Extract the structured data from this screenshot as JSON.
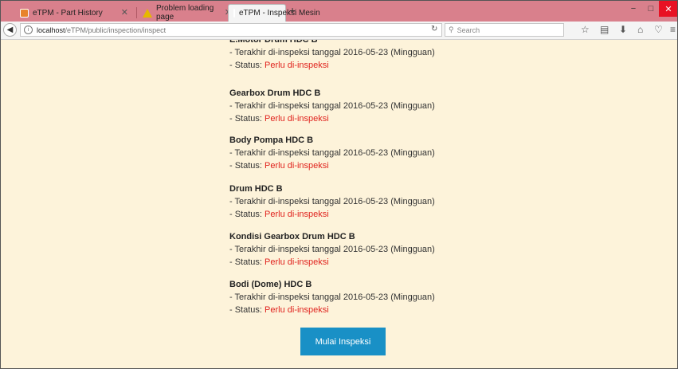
{
  "browser": {
    "tabs": [
      {
        "label": "eTPM - Part History",
        "icon": "etpm-favicon"
      },
      {
        "label": "Problem loading page",
        "icon": "warning-icon"
      },
      {
        "label": "eTPM - Inspeksi Mesin",
        "icon": "etpm-favicon"
      }
    ],
    "url_host": "localhost",
    "url_path": "/eTPM/public/inspection/inspect",
    "search_placeholder": "Search"
  },
  "items": [
    {
      "name": "E.Motor Drum HDC B",
      "last": "- Terakhir di-inspeksi tanggal 2016-05-23 (Mingguan)",
      "status_label": "- Status: ",
      "status_value": "Perlu di-inspeksi"
    },
    {
      "name": "Gearbox Drum HDC B",
      "last": "- Terakhir di-inspeksi tanggal 2016-05-23 (Mingguan)",
      "status_label": "- Status: ",
      "status_value": "Perlu di-inspeksi"
    },
    {
      "name": "Body Pompa HDC B",
      "last": "- Terakhir di-inspeksi tanggal 2016-05-23 (Mingguan)",
      "status_label": "- Status: ",
      "status_value": "Perlu di-inspeksi"
    },
    {
      "name": "Drum HDC B",
      "last": "- Terakhir di-inspeksi tanggal 2016-05-23 (Mingguan)",
      "status_label": "- Status: ",
      "status_value": "Perlu di-inspeksi"
    },
    {
      "name": "Kondisi Gearbox Drum HDC B",
      "last": "- Terakhir di-inspeksi tanggal 2016-05-23 (Mingguan)",
      "status_label": "- Status: ",
      "status_value": "Perlu di-inspeksi"
    },
    {
      "name": "Bodi (Dome) HDC B",
      "last": "- Terakhir di-inspeksi tanggal 2016-05-23 (Mingguan)",
      "status_label": "- Status: ",
      "status_value": "Perlu di-inspeksi"
    }
  ],
  "start_button": "Mulai Inspeksi",
  "colors": {
    "status": "#e0221d",
    "button": "#1990c6",
    "page_bg": "#fdf3da",
    "tabbar": "#d9808c"
  }
}
